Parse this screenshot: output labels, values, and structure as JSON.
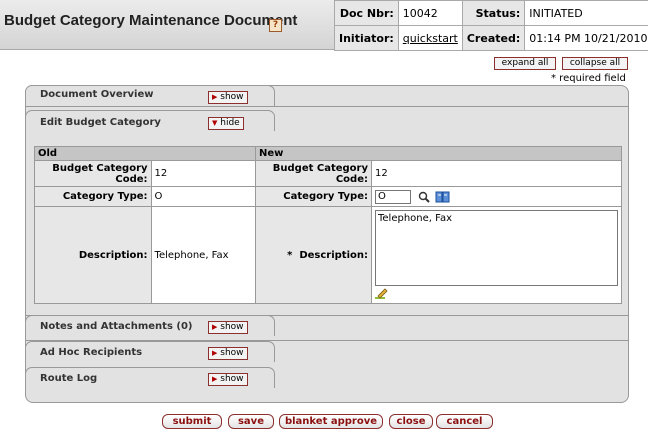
{
  "header": {
    "title": "Budget Category Maintenance Document",
    "help_icon": "?",
    "doc_nbr_label": "Doc Nbr:",
    "doc_nbr": "10042",
    "status_label": "Status:",
    "status": "INITIATED",
    "initiator_label": "Initiator:",
    "initiator": "quickstart",
    "created_label": "Created:",
    "created": "01:14 PM 10/21/2010"
  },
  "toolbar": {
    "expand_all": "expand all",
    "collapse_all": "collapse all",
    "required_note": "* required field"
  },
  "tabs": [
    {
      "title": "Document Overview",
      "button": "show"
    },
    {
      "title": "Edit Budget Category",
      "button": "hide"
    },
    {
      "title": "Notes and Attachments (0)",
      "button": "show"
    },
    {
      "title": "Ad Hoc Recipients",
      "button": "show"
    },
    {
      "title": "Route Log",
      "button": "show"
    }
  ],
  "edit": {
    "old_header": "Old",
    "new_header": "New",
    "code_label": "Budget Category Code:",
    "type_label": "Category Type:",
    "desc_label": "Description:",
    "required_star": "*",
    "old_code": "12",
    "old_type": "O",
    "old_desc": "Telephone, Fax",
    "new_code": "12",
    "new_type": "O",
    "new_desc": "Telephone, Fax"
  },
  "buttons": {
    "submit": "submit",
    "save": "save",
    "blanket_approve": "blanket approve",
    "close": "close",
    "cancel": "cancel"
  },
  "icons": {
    "lookup": "magnifier-icon",
    "inquiry": "book-icon",
    "edit": "pencil-icon"
  }
}
